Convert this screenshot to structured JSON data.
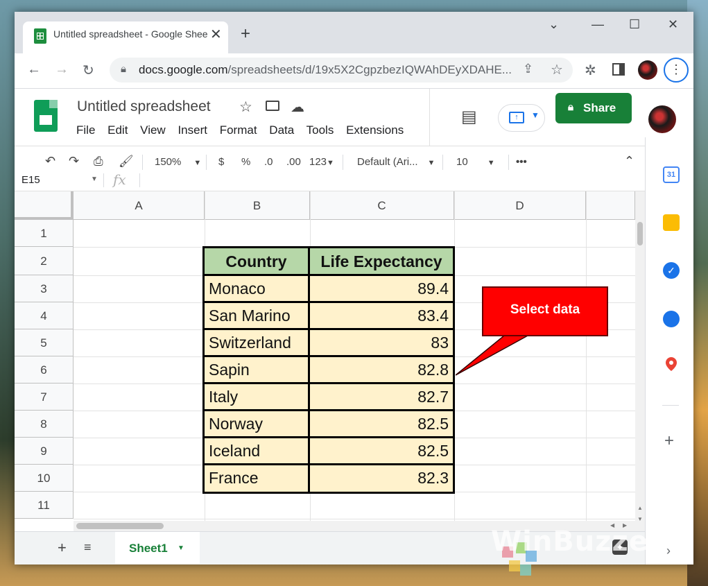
{
  "browser": {
    "tab_title": "Untitled spreadsheet - Google Sheets",
    "new_tab": "+",
    "url_host": "docs.google.com",
    "url_path": "/spreadsheets/d/19x5X2CgpzbezIQWAhDEyXDAHE..."
  },
  "docs": {
    "title": "Untitled spreadsheet",
    "menu": [
      "File",
      "Edit",
      "View",
      "Insert",
      "Format",
      "Data",
      "Tools",
      "Extensions"
    ],
    "share_label": "Share"
  },
  "toolbar": {
    "zoom": "150%",
    "currency": "$",
    "percent": "%",
    "dec_decrease": ".0",
    "dec_increase": ".00",
    "more_formats": "123",
    "font": "Default (Ari...",
    "font_size": "10",
    "more": "•••"
  },
  "formula_bar": {
    "name_box": "E15",
    "fx": "fx"
  },
  "sheet": {
    "columns": [
      "A",
      "B",
      "C",
      "D"
    ],
    "rows": [
      "1",
      "2",
      "3",
      "4",
      "5",
      "6",
      "7",
      "8",
      "9",
      "10",
      "11"
    ],
    "table_header": [
      "Country",
      "Life Expectancy"
    ],
    "table_rows": [
      [
        "Monaco",
        "89.4"
      ],
      [
        "San Marino",
        "83.4"
      ],
      [
        "Switzerland",
        "83"
      ],
      [
        "Sapin",
        "82.8"
      ],
      [
        "Italy",
        "82.7"
      ],
      [
        "Norway",
        "82.5"
      ],
      [
        "Iceland",
        "82.5"
      ],
      [
        "France",
        "82.3"
      ]
    ],
    "header_fill": "#b6d7a8",
    "data_fill": "#fff2cc"
  },
  "callout": {
    "text": "Select data",
    "color": "#ff0000"
  },
  "bottom": {
    "add": "+",
    "sheet_tab": "Sheet1"
  },
  "watermark": "WinBuzzer"
}
